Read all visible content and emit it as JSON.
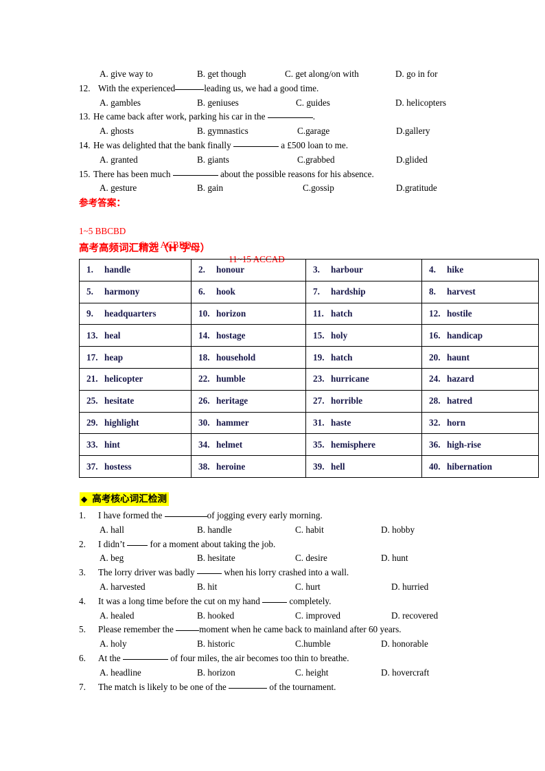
{
  "top_questions": [
    {
      "id": "q11-options",
      "stem": null,
      "options": [
        "A. give way to",
        "B. get though",
        "C. get along/on with",
        "D. go in for"
      ]
    },
    {
      "id": "q12",
      "number": "12.",
      "stem_before": "With the experienced",
      "stem_after": "leading us, we had a good time.",
      "options": [
        "A. gambles",
        "B. geniuses",
        "C. guides",
        "D. helicopters"
      ]
    },
    {
      "id": "q13",
      "number": "13.",
      "stem_before": "He came back after work, parking his car in the ",
      "stem_after": ".",
      "options": [
        "A. ghosts",
        "B. gymnastics",
        "C.garage",
        "D.gallery"
      ]
    },
    {
      "id": "q14",
      "number": "14.",
      "stem_before": "He was delighted that the bank finally ",
      "stem_after": " a £500 loan to me.",
      "options": [
        "A. granted",
        "B. giants",
        "C.grabbed",
        "D.glided"
      ]
    },
    {
      "id": "q15",
      "number": "15.",
      "stem_before": "There has been much ",
      "stem_after": " about the possible reasons for his absence.",
      "options": [
        "A. gesture",
        "B. gain",
        "C.gossip",
        "D.gratitude"
      ]
    }
  ],
  "answer_key": {
    "title": "参考答案：",
    "lines": [
      "1~5 BBCBD",
      "6~10 ACBBD",
      "11~15 ACCAD"
    ],
    "color": "#FF0000"
  },
  "vocab_section": {
    "heading": "高考高频词汇精选（H 字母）",
    "heading_color": "#FF0000",
    "text_color": "#18184a",
    "words": [
      {
        "n": "1.",
        "w": "handle"
      },
      {
        "n": "2.",
        "w": "honour"
      },
      {
        "n": "3.",
        "w": "harbour"
      },
      {
        "n": "4.",
        "w": "hike"
      },
      {
        "n": "5.",
        "w": "harmony"
      },
      {
        "n": "6.",
        "w": "hook"
      },
      {
        "n": "7.",
        "w": "hardship"
      },
      {
        "n": "8.",
        "w": "harvest"
      },
      {
        "n": "9.",
        "w": "headquarters"
      },
      {
        "n": "10.",
        "w": "horizon"
      },
      {
        "n": "11.",
        "w": "hatch"
      },
      {
        "n": "12.",
        "w": "hostile"
      },
      {
        "n": "13.",
        "w": "heal"
      },
      {
        "n": "14.",
        "w": "hostage"
      },
      {
        "n": "15.",
        "w": "holy"
      },
      {
        "n": "16.",
        "w": "handicap"
      },
      {
        "n": "17.",
        "w": "heap"
      },
      {
        "n": "18.",
        "w": "household"
      },
      {
        "n": "19.",
        "w": "hatch"
      },
      {
        "n": "20.",
        "w": "haunt"
      },
      {
        "n": "21.",
        "w": "helicopter"
      },
      {
        "n": "22.",
        "w": "humble"
      },
      {
        "n": "23.",
        "w": "hurricane"
      },
      {
        "n": "24.",
        "w": "hazard"
      },
      {
        "n": "25.",
        "w": "hesitate"
      },
      {
        "n": "26.",
        "w": "heritage"
      },
      {
        "n": "27.",
        "w": "horrible"
      },
      {
        "n": "28.",
        "w": "hatred"
      },
      {
        "n": "29.",
        "w": "highlight"
      },
      {
        "n": "30.",
        "w": "hammer"
      },
      {
        "n": "31.",
        "w": "haste"
      },
      {
        "n": "32.",
        "w": "horn"
      },
      {
        "n": "33.",
        "w": "hint"
      },
      {
        "n": "34.",
        "w": "helmet"
      },
      {
        "n": "35.",
        "w": "hemisphere"
      },
      {
        "n": "36.",
        "w": "high-rise"
      },
      {
        "n": "37.",
        "w": "hostess"
      },
      {
        "n": "38.",
        "w": "heroine"
      },
      {
        "n": "39.",
        "w": "hell"
      },
      {
        "n": "40.",
        "w": "hibernation"
      }
    ]
  },
  "test_section": {
    "bullet": "◆",
    "heading": "高考核心词汇检测",
    "highlight_color": "#FFFF00",
    "questions": [
      {
        "number": "1.",
        "stem_before": "I have formed the ",
        "stem_after": "of jogging every early morning.",
        "options": [
          "A. hall",
          "B. handle",
          "C. habit",
          "D. hobby"
        ]
      },
      {
        "number": "2.",
        "stem_before": "I didn’t ",
        "stem_after": " for a moment about taking the job.",
        "options": [
          "A. beg",
          "B. hesitate",
          "C. desire",
          "D. hunt"
        ]
      },
      {
        "number": "3.",
        "stem_before": "The lorry driver was badly ",
        "stem_after": " when his lorry crashed into a wall.",
        "options": [
          "A. harvested",
          "B. hit",
          "C. hurt",
          "D. hurried"
        ]
      },
      {
        "number": "4.",
        "stem_before": "It was a long time before the cut on my hand ",
        "stem_after": " completely.",
        "options": [
          "A. healed",
          "B. hooked",
          "C. improved",
          "D. recovered"
        ]
      },
      {
        "number": "5.",
        "stem_before": "Please remember the ",
        "stem_after": "moment when he came back to mainland after 60 years.",
        "options": [
          "A. holy",
          "B. historic",
          "C.humble",
          "D. honorable"
        ]
      },
      {
        "number": "6.",
        "stem_before": "At the ",
        "stem_after": " of four miles, the air becomes too thin to breathe.",
        "options": [
          "A. headline",
          "B. horizon",
          "C. height",
          "D. hovercraft"
        ]
      },
      {
        "number": "7.",
        "stem_before": "The match is likely to be one of the ",
        "stem_after": " of the tournament.",
        "options": []
      }
    ]
  }
}
